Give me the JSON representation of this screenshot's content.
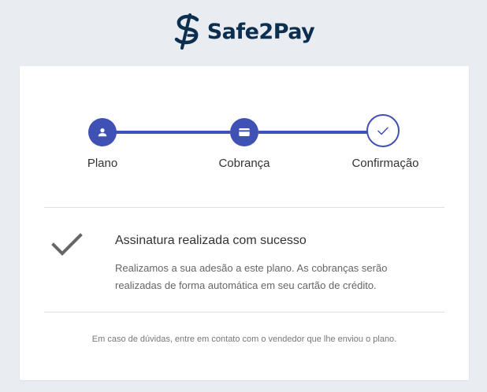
{
  "brand": {
    "name": "Safe2Pay",
    "logo_icon": "safe2pay-logo-icon",
    "color": "#0d2f4f"
  },
  "colors": {
    "accent": "#3f51b5",
    "page_background": "#e9ecf0",
    "card_background": "#ffffff"
  },
  "stepper": {
    "steps": [
      {
        "label": "Plano",
        "icon": "person-icon",
        "status": "completed"
      },
      {
        "label": "Cobrança",
        "icon": "credit-card-icon",
        "status": "completed"
      },
      {
        "label": "Confirmação",
        "icon": "check-icon",
        "status": "current"
      }
    ]
  },
  "confirmation": {
    "icon": "checkmark-icon",
    "title": "Assinatura realizada com sucesso",
    "description": "Realizamos a sua adesão a este plano. As cobranças serão realizadas de forma automática em seu cartão de crédito."
  },
  "footer": {
    "note": "Em caso de dúvidas, entre em contato com o vendedor que lhe enviou o plano."
  }
}
